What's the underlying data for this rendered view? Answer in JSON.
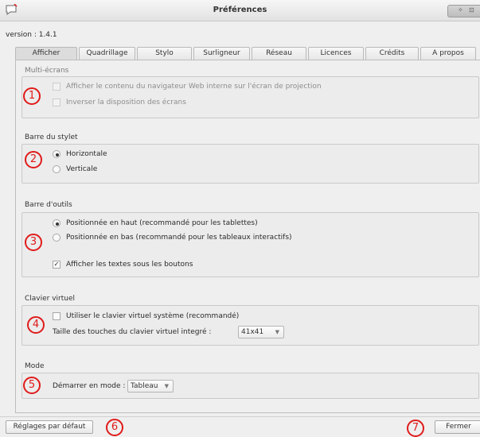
{
  "window": {
    "title": "Préférences"
  },
  "version_text": "version : 1.4.1",
  "tabs": [
    {
      "label": "Afficher",
      "active": true
    },
    {
      "label": "Quadrillage"
    },
    {
      "label": "Stylo"
    },
    {
      "label": "Surligneur"
    },
    {
      "label": "Réseau"
    },
    {
      "label": "Licences"
    },
    {
      "label": "Crédits"
    },
    {
      "label": "A propos"
    }
  ],
  "sections": {
    "multiscreen": {
      "title": "Multi-écrans",
      "badge": "1",
      "options": [
        {
          "label": "Afficher le contenu du navigateur Web interne sur l'écran de projection",
          "checked": false,
          "enabled": false
        },
        {
          "label": "Inverser la disposition des écrans",
          "checked": false,
          "enabled": false
        }
      ]
    },
    "stylus_bar": {
      "title": "Barre du stylet",
      "badge": "2",
      "options": [
        {
          "label": "Horizontale",
          "selected": true
        },
        {
          "label": "Verticale",
          "selected": false
        }
      ]
    },
    "toolbar": {
      "title": "Barre d'outils",
      "badge": "3",
      "options": [
        {
          "label": "Positionnée en haut (recommandé pour les tablettes)",
          "selected": true
        },
        {
          "label": "Positionnée en bas (recommandé pour les tableaux interactifs)",
          "selected": false
        }
      ],
      "show_labels": {
        "label": "Afficher les textes sous les boutons",
        "checked": true
      }
    },
    "virtual_keyboard": {
      "title": "Clavier virtuel",
      "badge": "4",
      "system_kb": {
        "label": "Utiliser le clavier virtuel système (recommandé)",
        "checked": false
      },
      "key_size_label": "Taille des touches du clavier virtuel integré :",
      "key_size_value": "41x41"
    },
    "mode": {
      "title": "Mode",
      "badge": "5",
      "start_label": "Démarrer en mode :",
      "start_value": "Tableau"
    }
  },
  "footer": {
    "defaults_button": "Réglages par défaut",
    "defaults_badge": "6",
    "close_button": "Fermer",
    "close_badge": "7"
  },
  "colors": {
    "badge": "#e01b1b",
    "panel_bg": "#efefef"
  },
  "icons": {
    "app": "chat-bubble-icon",
    "minimize": "up-arrow-icon",
    "maximize": "square-icon"
  }
}
